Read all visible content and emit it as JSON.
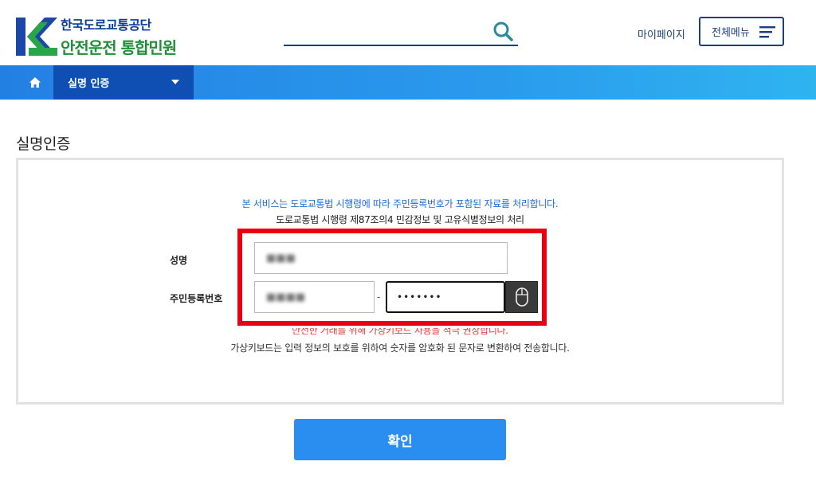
{
  "header": {
    "logo_line1": "한국도로교통공단",
    "logo_line2": "안전운전 통합민원",
    "search_placeholder": "",
    "mypage_label": "마이페이지",
    "allmenu_label": "전체메뉴"
  },
  "nav": {
    "home_icon": "home-icon",
    "breadcrumb_label": "실명 인증"
  },
  "page": {
    "title": "실명인증"
  },
  "form": {
    "notice_blue": "본 서비스는 도로교통법 시행령에 따라 주민등록번호가 포함된 자료를 처리합니다.",
    "notice_black": "도로교통법 시행령 제87조의4 민감정보 및 고유식별정보의 처리",
    "name_label": "성명",
    "name_value": "■■■",
    "rrn_label": "주민등록번호",
    "rrn_front_value": "■■■■",
    "rrn_separator": "-",
    "rrn_back_value": "•••••••",
    "warning_text": "안전한 거래를 위해 가상키보드 사용을 적극 권장합니다.",
    "info_text": "가상키보드는 입력 정보의 보호를 위하여 숫자를 암호화 된 문자로 변환하여 전송합니다."
  },
  "actions": {
    "confirm_label": "확인"
  },
  "colors": {
    "brand_blue": "#1c3f7c",
    "brand_green": "#1f8f3a",
    "nav_dark": "#0f4fb4",
    "accent_blue": "#2a8ef0",
    "highlight_red": "#e60012"
  }
}
